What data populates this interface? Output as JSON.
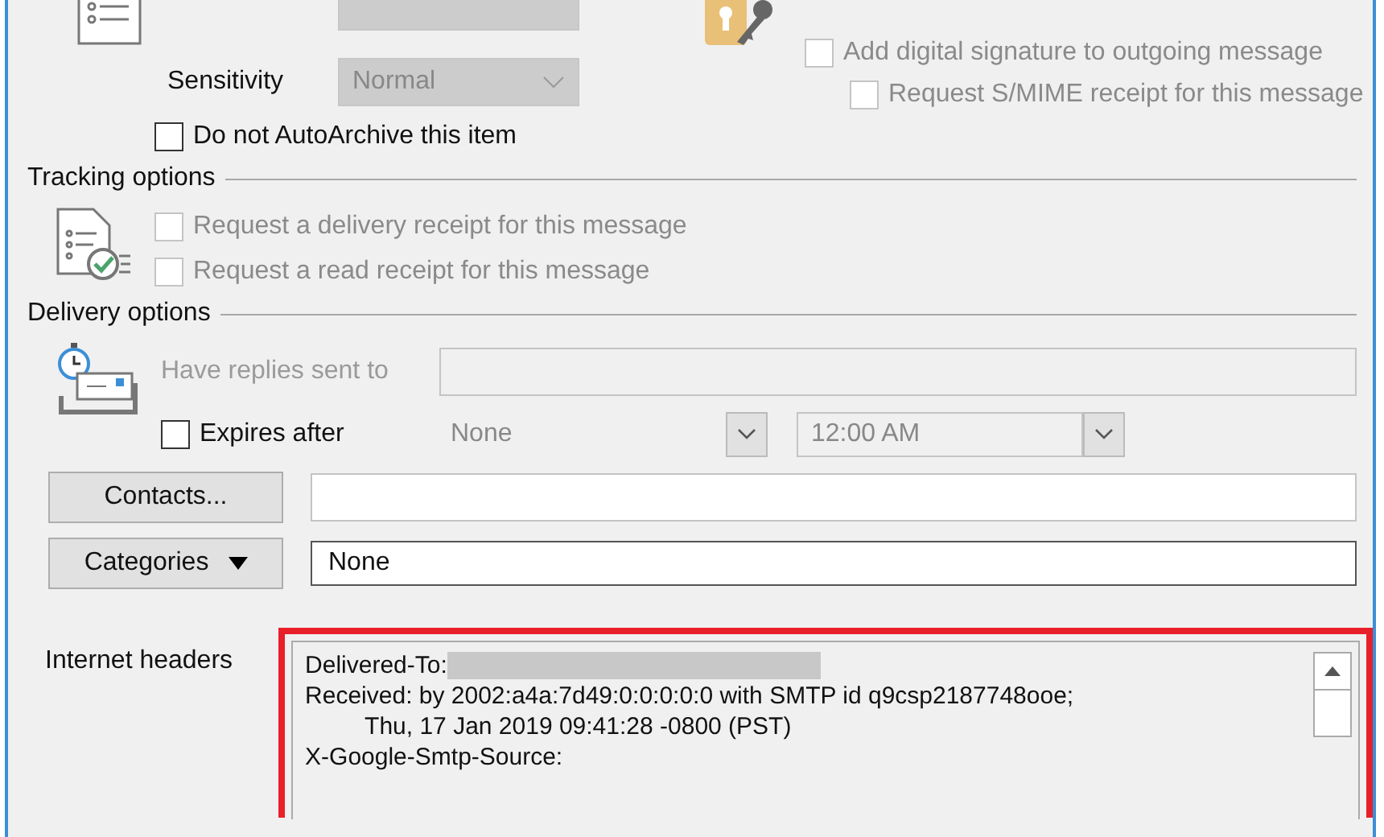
{
  "properties": {
    "fields": [
      {
        "label": "Sensitivity",
        "value": "Normal",
        "disabled": true
      }
    ],
    "autoarchive": {
      "label": "Do not AutoArchive this item",
      "checked": false
    }
  },
  "security": {
    "options": [
      {
        "label": "Add digital signature to outgoing message",
        "checked": false,
        "disabled": true,
        "children": [
          {
            "label": "Request S/MIME receipt for this message",
            "checked": false,
            "disabled": true
          }
        ]
      }
    ]
  },
  "tracking": {
    "title": "Tracking options",
    "options": [
      {
        "label": "Request a delivery receipt for this message",
        "checked": false,
        "disabled": true
      },
      {
        "label": "Request a read receipt for this message",
        "checked": false,
        "disabled": true
      }
    ]
  },
  "delivery": {
    "title": "Delivery options",
    "replies": {
      "label": "Have replies sent to",
      "disabled": true
    },
    "expires": {
      "label": "Expires after",
      "checked": false,
      "date": "None",
      "time": "12:00 AM"
    }
  },
  "contacts": {
    "button": "Contacts..."
  },
  "categories": {
    "button": "Categories",
    "value": "None"
  },
  "headers": {
    "label": "Internet headers",
    "highlighted": true,
    "lines": [
      {
        "kind": "redacted",
        "text": "Delivered-To:"
      },
      {
        "kind": "plain",
        "text": "Received: by 2002:a4a:7d49:0:0:0:0:0 with SMTP id q9csp2187748ooe;"
      },
      {
        "kind": "continuation",
        "text": "Thu, 17 Jan 2019 09:41:28 -0800 (PST)"
      },
      {
        "kind": "plain",
        "text": "X-Google-Smtp-Source:"
      }
    ]
  }
}
